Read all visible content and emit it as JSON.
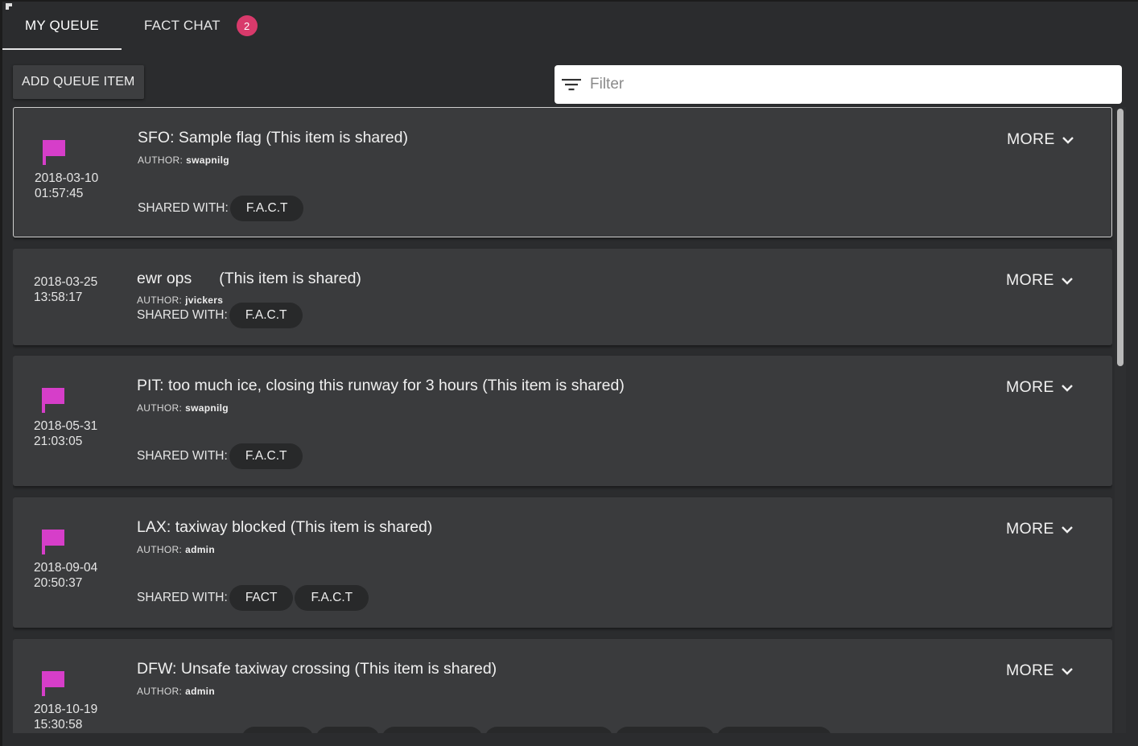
{
  "tabs": {
    "my_queue": "MY QUEUE",
    "fact_chat": "FACT CHAT",
    "fact_chat_badge": "2"
  },
  "toolbar": {
    "add_button": "ADD QUEUE ITEM",
    "filter_placeholder": "Filter"
  },
  "labels": {
    "author": "AUTHOR:",
    "shared_with": "SHARED WITH:",
    "more": "MORE"
  },
  "items": [
    {
      "date": "2018-03-10",
      "time": "01:57:45",
      "title": "SFO: Sample flag (This item is shared)",
      "author": "swapnilg",
      "shared": [
        "F.A.C.T"
      ],
      "flagged": true,
      "selected": true
    },
    {
      "date": "2018-03-25",
      "time": "13:58:17",
      "title_main": "ewr ops",
      "title_suffix": "(This item is shared)",
      "author": "jvickers",
      "shared": [
        "F.A.C.T"
      ],
      "flagged": false
    },
    {
      "date": "2018-05-31",
      "time": "21:03:05",
      "title": "PIT: too much ice, closing this runway for 3 hours (This item is shared)",
      "author": "swapnilg",
      "shared": [
        "F.A.C.T"
      ],
      "flagged": true
    },
    {
      "date": "2018-09-04",
      "time": "20:50:37",
      "title": "LAX: taxiway blocked (This item is shared)",
      "author": "admin",
      "shared": [
        "FACT",
        "F.A.C.T"
      ],
      "flagged": true
    },
    {
      "date": "2018-10-19",
      "time": "15:30:58",
      "title": "DFW: Unsafe taxiway crossing (This item is shared)",
      "author": "admin",
      "flagged": true
    }
  ],
  "colors": {
    "flag": "#d63ec9",
    "badge": "#d83a6b",
    "card": "#3a3b3d",
    "background": "#2b2c2e"
  }
}
